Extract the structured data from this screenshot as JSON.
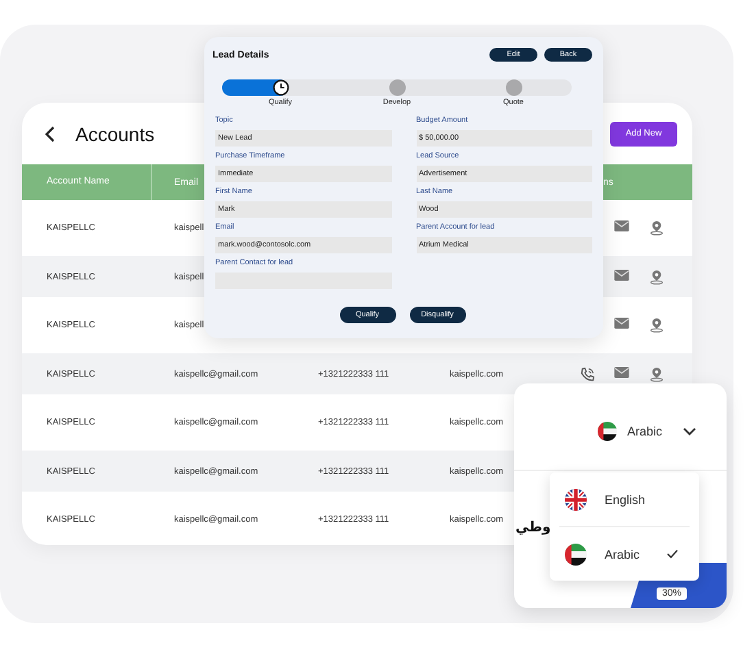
{
  "accounts": {
    "title": "Accounts",
    "add_button": "Add New",
    "columns": [
      "Account Name",
      "Email",
      "ns"
    ],
    "rows": [
      {
        "name": "KAISPELLC",
        "email": "kaispell",
        "actions": [
          {
            "kind": "mail"
          },
          {
            "kind": "location"
          }
        ]
      },
      {
        "name": "KAISPELLC",
        "email": "kaispell",
        "actions": [
          {
            "kind": "mail"
          },
          {
            "kind": "location"
          }
        ]
      },
      {
        "name": "KAISPELLC",
        "email": "kaispell",
        "actions": [
          {
            "kind": "mail"
          },
          {
            "kind": "location"
          }
        ]
      },
      {
        "name": "KAISPELLC",
        "email": "kaispellc@gmail.com",
        "phone": "+1321222333 111",
        "website": "kaispellc.com",
        "actions": [
          {
            "kind": "phone"
          },
          {
            "kind": "mail"
          },
          {
            "kind": "location"
          }
        ]
      },
      {
        "name": "KAISPELLC",
        "email": "kaispellc@gmail.com",
        "phone": "+1321222333 111",
        "website": "kaispellc.com",
        "actions": []
      },
      {
        "name": "KAISPELLC",
        "email": "kaispellc@gmail.com",
        "phone": "+1321222333 111",
        "website": "kaispellc.com",
        "actions": []
      },
      {
        "name": "KAISPELLC",
        "email": "kaispellc@gmail.com",
        "phone": "+1321222333 111",
        "website": "kaispellc.com",
        "actions": []
      }
    ]
  },
  "lead_details": {
    "title": "Lead Details",
    "buttons": [
      "Edit",
      "Back"
    ],
    "level": 0.19,
    "stages": [
      {
        "label": "Qualify",
        "kind": "current"
      },
      {
        "label": "Develop",
        "kind": "pending"
      },
      {
        "label": "Quote",
        "kind": "pending"
      }
    ],
    "left_fields": [
      {
        "label": "Topic",
        "value": "New Lead"
      },
      {
        "label": "Purchase Timeframe",
        "value": "Immediate"
      },
      {
        "label": "First Name",
        "value": "Mark"
      },
      {
        "label": "Email",
        "value": "mark.wood@contosolc.com"
      },
      {
        "label": "Parent Contact for lead"
      }
    ],
    "right_fields": [
      {
        "label": "Budget Amount",
        "value": "$ 50,000.00"
      },
      {
        "label": "Lead Source",
        "value": "Advertisement"
      },
      {
        "label": "Last Name",
        "value": "Wood"
      },
      {
        "label": "Parent Account for lead",
        "value": "Atrium Medical"
      }
    ],
    "actions": [
      "Qualify",
      "Disqualify"
    ]
  },
  "language": {
    "current": {
      "label": "Arabic",
      "flag": {
        "kind": "uae"
      }
    },
    "backdrop_text": "وطي",
    "badge": "30%",
    "options": [
      {
        "label": "English",
        "flag": {
          "kind": "uk"
        },
        "selected": false
      },
      {
        "label": "Arabic",
        "flag": {
          "kind": "uae"
        },
        "selected": true
      }
    ]
  }
}
